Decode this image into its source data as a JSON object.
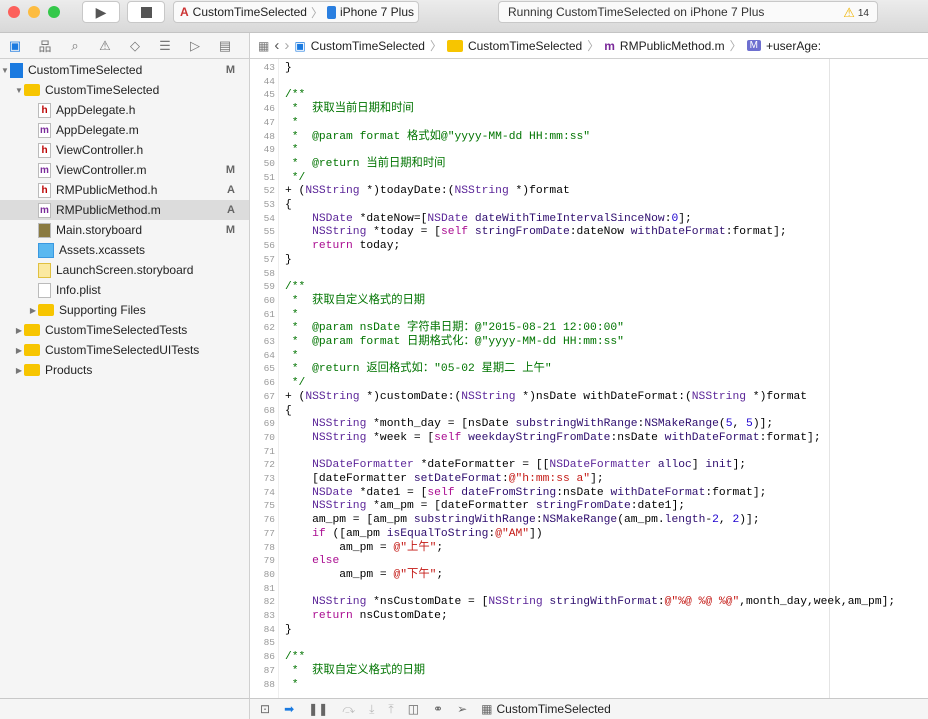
{
  "toolbar": {
    "scheme": "CustomTimeSelected",
    "device": "iPhone 7 Plus",
    "status": "Running CustomTimeSelected on iPhone 7 Plus",
    "warning_count": "14"
  },
  "jumpbar": [
    "CustomTimeSelected",
    "CustomTimeSelected",
    "RMPublicMethod.m",
    "+userAge:"
  ],
  "navigator": [
    {
      "label": "CustomTimeSelected",
      "indent": 0,
      "kind": "project",
      "open": true,
      "badge": "M"
    },
    {
      "label": "CustomTimeSelected",
      "indent": 1,
      "kind": "folder",
      "open": true,
      "badge": ""
    },
    {
      "label": "AppDelegate.h",
      "indent": 2,
      "kind": "h",
      "badge": ""
    },
    {
      "label": "AppDelegate.m",
      "indent": 2,
      "kind": "m",
      "badge": ""
    },
    {
      "label": "ViewController.h",
      "indent": 2,
      "kind": "h",
      "badge": ""
    },
    {
      "label": "ViewController.m",
      "indent": 2,
      "kind": "m",
      "badge": "M"
    },
    {
      "label": "RMPublicMethod.h",
      "indent": 2,
      "kind": "h",
      "badge": "A"
    },
    {
      "label": "RMPublicMethod.m",
      "indent": 2,
      "kind": "m",
      "badge": "A",
      "selected": true
    },
    {
      "label": "Main.storyboard",
      "indent": 2,
      "kind": "storyboard",
      "badge": "M"
    },
    {
      "label": "Assets.xcassets",
      "indent": 2,
      "kind": "assets",
      "badge": ""
    },
    {
      "label": "LaunchScreen.storyboard",
      "indent": 2,
      "kind": "launch",
      "badge": ""
    },
    {
      "label": "Info.plist",
      "indent": 2,
      "kind": "plist",
      "badge": ""
    },
    {
      "label": "Supporting Files",
      "indent": 2,
      "kind": "folder",
      "open": false,
      "badge": ""
    },
    {
      "label": "CustomTimeSelectedTests",
      "indent": 1,
      "kind": "folder",
      "open": false,
      "badge": ""
    },
    {
      "label": "CustomTimeSelectedUITests",
      "indent": 1,
      "kind": "folder",
      "open": false,
      "badge": ""
    },
    {
      "label": "Products",
      "indent": 1,
      "kind": "folder",
      "open": false,
      "badge": ""
    }
  ],
  "code": [
    {
      "n": "43",
      "t": [
        [
          "p",
          "}"
        ]
      ]
    },
    {
      "n": "44",
      "t": []
    },
    {
      "n": "45",
      "t": [
        [
          "c",
          "/**"
        ]
      ]
    },
    {
      "n": "46",
      "t": [
        [
          "c",
          " *  获取当前日期和时间"
        ]
      ]
    },
    {
      "n": "47",
      "t": [
        [
          "c",
          " *"
        ]
      ]
    },
    {
      "n": "48",
      "t": [
        [
          "c",
          " *  @param format 格式如@\"yyyy-MM-dd HH:mm:ss\""
        ]
      ]
    },
    {
      "n": "49",
      "t": [
        [
          "c",
          " *"
        ]
      ]
    },
    {
      "n": "50",
      "t": [
        [
          "c",
          " *  @return 当前日期和时间"
        ]
      ]
    },
    {
      "n": "51",
      "t": [
        [
          "c",
          " */"
        ]
      ]
    },
    {
      "n": "52",
      "t": [
        [
          "p",
          "+ ("
        ],
        [
          "t",
          "NSString"
        ],
        [
          "p",
          " *)todayDate:("
        ],
        [
          "t",
          "NSString"
        ],
        [
          "p",
          " *)format"
        ]
      ]
    },
    {
      "n": "53",
      "t": [
        [
          "p",
          "{"
        ]
      ]
    },
    {
      "n": "54",
      "t": [
        [
          "p",
          "    "
        ],
        [
          "t",
          "NSDate"
        ],
        [
          "p",
          " *dateNow=["
        ],
        [
          "t",
          "NSDate"
        ],
        [
          "p",
          " "
        ],
        [
          "m",
          "dateWithTimeIntervalSinceNow"
        ],
        [
          "p",
          ":"
        ],
        [
          "n",
          "0"
        ],
        [
          "p",
          "];"
        ]
      ]
    },
    {
      "n": "55",
      "t": [
        [
          "p",
          "    "
        ],
        [
          "t",
          "NSString"
        ],
        [
          "p",
          " *today = ["
        ],
        [
          "k",
          "self"
        ],
        [
          "p",
          " "
        ],
        [
          "m",
          "stringFromDate"
        ],
        [
          "p",
          ":dateNow "
        ],
        [
          "m",
          "withDateFormat"
        ],
        [
          "p",
          ":format];"
        ]
      ]
    },
    {
      "n": "56",
      "t": [
        [
          "p",
          "    "
        ],
        [
          "k",
          "return"
        ],
        [
          "p",
          " today;"
        ]
      ]
    },
    {
      "n": "57",
      "t": [
        [
          "p",
          "}"
        ]
      ]
    },
    {
      "n": "58",
      "t": []
    },
    {
      "n": "59",
      "t": [
        [
          "c",
          "/**"
        ]
      ]
    },
    {
      "n": "60",
      "t": [
        [
          "c",
          " *  获取自定义格式的日期"
        ]
      ]
    },
    {
      "n": "61",
      "t": [
        [
          "c",
          " *"
        ]
      ]
    },
    {
      "n": "62",
      "t": [
        [
          "c",
          " *  @param nsDate 字符串日期：@\"2015-08-21 12:00:00\""
        ]
      ]
    },
    {
      "n": "63",
      "t": [
        [
          "c",
          " *  @param format 日期格式化：@\"yyyy-MM-dd HH:mm:ss\""
        ]
      ]
    },
    {
      "n": "64",
      "t": [
        [
          "c",
          " *"
        ]
      ]
    },
    {
      "n": "65",
      "t": [
        [
          "c",
          " *  @return 返回格式如：\"05-02 星期二 上午\""
        ]
      ]
    },
    {
      "n": "66",
      "t": [
        [
          "c",
          " */"
        ]
      ]
    },
    {
      "n": "67",
      "t": [
        [
          "p",
          "+ ("
        ],
        [
          "t",
          "NSString"
        ],
        [
          "p",
          " *)customDate:("
        ],
        [
          "t",
          "NSString"
        ],
        [
          "p",
          " *)nsDate withDateFormat:("
        ],
        [
          "t",
          "NSString"
        ],
        [
          "p",
          " *)format"
        ]
      ]
    },
    {
      "n": "68",
      "t": [
        [
          "p",
          "{"
        ]
      ]
    },
    {
      "n": "69",
      "t": [
        [
          "p",
          "    "
        ],
        [
          "t",
          "NSString"
        ],
        [
          "p",
          " *month_day = [nsDate "
        ],
        [
          "m",
          "substringWithRange"
        ],
        [
          "p",
          ":"
        ],
        [
          "m",
          "NSMakeRange"
        ],
        [
          "p",
          "("
        ],
        [
          "n",
          "5"
        ],
        [
          "p",
          ", "
        ],
        [
          "n",
          "5"
        ],
        [
          "p",
          ")];"
        ]
      ]
    },
    {
      "n": "70",
      "t": [
        [
          "p",
          "    "
        ],
        [
          "t",
          "NSString"
        ],
        [
          "p",
          " *week = ["
        ],
        [
          "k",
          "self"
        ],
        [
          "p",
          " "
        ],
        [
          "m",
          "weekdayStringFromDate"
        ],
        [
          "p",
          ":nsDate "
        ],
        [
          "m",
          "withDateFormat"
        ],
        [
          "p",
          ":format];"
        ]
      ]
    },
    {
      "n": "71",
      "t": []
    },
    {
      "n": "72",
      "t": [
        [
          "p",
          "    "
        ],
        [
          "t",
          "NSDateFormatter"
        ],
        [
          "p",
          " *dateFormatter = [["
        ],
        [
          "t",
          "NSDateFormatter"
        ],
        [
          "p",
          " "
        ],
        [
          "m",
          "alloc"
        ],
        [
          "p",
          "] "
        ],
        [
          "m",
          "init"
        ],
        [
          "p",
          "];"
        ]
      ]
    },
    {
      "n": "73",
      "t": [
        [
          "p",
          "    [dateFormatter "
        ],
        [
          "m",
          "setDateFormat"
        ],
        [
          "p",
          ":"
        ],
        [
          "s",
          "@\"h:mm:ss a\""
        ],
        [
          "p",
          "];"
        ]
      ]
    },
    {
      "n": "74",
      "t": [
        [
          "p",
          "    "
        ],
        [
          "t",
          "NSDate"
        ],
        [
          "p",
          " *date1 = ["
        ],
        [
          "k",
          "self"
        ],
        [
          "p",
          " "
        ],
        [
          "m",
          "dateFromString"
        ],
        [
          "p",
          ":nsDate "
        ],
        [
          "m",
          "withDateFormat"
        ],
        [
          "p",
          ":format];"
        ]
      ]
    },
    {
      "n": "75",
      "t": [
        [
          "p",
          "    "
        ],
        [
          "t",
          "NSString"
        ],
        [
          "p",
          " *am_pm = [dateFormatter "
        ],
        [
          "m",
          "stringFromDate"
        ],
        [
          "p",
          ":date1];"
        ]
      ]
    },
    {
      "n": "76",
      "t": [
        [
          "p",
          "    am_pm = [am_pm "
        ],
        [
          "m",
          "substringWithRange"
        ],
        [
          "p",
          ":"
        ],
        [
          "m",
          "NSMakeRange"
        ],
        [
          "p",
          "(am_pm."
        ],
        [
          "m",
          "length"
        ],
        [
          "p",
          "-"
        ],
        [
          "n",
          "2"
        ],
        [
          "p",
          ", "
        ],
        [
          "n",
          "2"
        ],
        [
          "p",
          ")];"
        ]
      ]
    },
    {
      "n": "77",
      "t": [
        [
          "p",
          "    "
        ],
        [
          "k",
          "if"
        ],
        [
          "p",
          " ([am_pm "
        ],
        [
          "m",
          "isEqualToString"
        ],
        [
          "p",
          ":"
        ],
        [
          "s",
          "@\"AM\""
        ],
        [
          "p",
          "])"
        ]
      ]
    },
    {
      "n": "78",
      "t": [
        [
          "p",
          "        am_pm = "
        ],
        [
          "s",
          "@\"上午\""
        ],
        [
          "p",
          ";"
        ]
      ]
    },
    {
      "n": "79",
      "t": [
        [
          "p",
          "    "
        ],
        [
          "k",
          "else"
        ]
      ]
    },
    {
      "n": "80",
      "t": [
        [
          "p",
          "        am_pm = "
        ],
        [
          "s",
          "@\"下午\""
        ],
        [
          "p",
          ";"
        ]
      ]
    },
    {
      "n": "81",
      "t": []
    },
    {
      "n": "82",
      "t": [
        [
          "p",
          "    "
        ],
        [
          "t",
          "NSString"
        ],
        [
          "p",
          " *nsCustomDate = ["
        ],
        [
          "t",
          "NSString"
        ],
        [
          "p",
          " "
        ],
        [
          "m",
          "stringWithFormat"
        ],
        [
          "p",
          ":"
        ],
        [
          "s",
          "@\"%@ %@ %@\""
        ],
        [
          "p",
          ",month_day,week,am_pm];"
        ]
      ]
    },
    {
      "n": "83",
      "t": [
        [
          "p",
          "    "
        ],
        [
          "k",
          "return"
        ],
        [
          "p",
          " nsCustomDate;"
        ]
      ]
    },
    {
      "n": "84",
      "t": [
        [
          "p",
          "}"
        ]
      ]
    },
    {
      "n": "85",
      "t": []
    },
    {
      "n": "86",
      "t": [
        [
          "c",
          "/**"
        ]
      ]
    },
    {
      "n": "87",
      "t": [
        [
          "c",
          " *  获取自定义格式的日期"
        ]
      ]
    },
    {
      "n": "88",
      "t": [
        [
          "c",
          " *"
        ]
      ]
    }
  ],
  "debugbar": {
    "target": "CustomTimeSelected"
  }
}
